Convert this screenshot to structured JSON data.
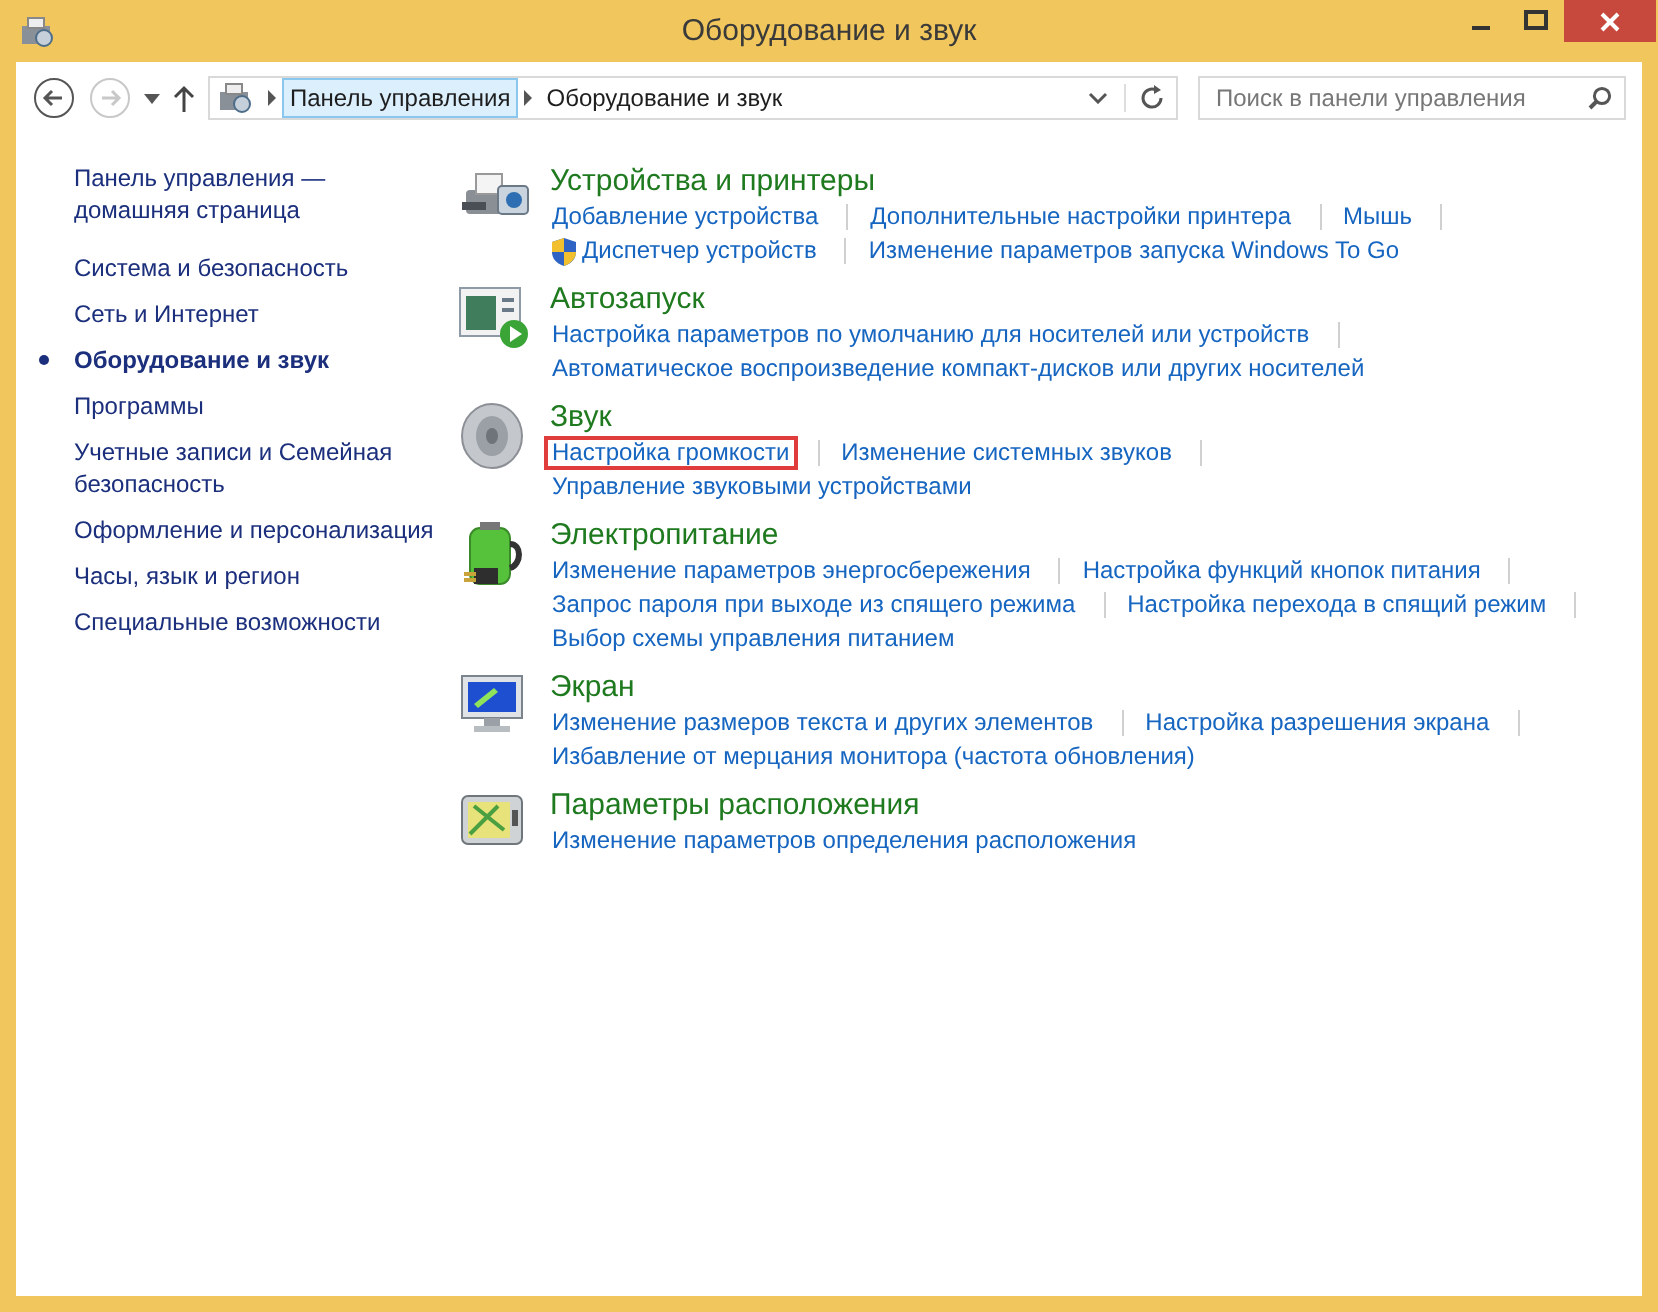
{
  "window": {
    "title": "Оборудование и звук"
  },
  "address": {
    "crumbs": [
      {
        "label": "Панель управления",
        "selected": true
      },
      {
        "label": "Оборудование и звук",
        "selected": false
      }
    ]
  },
  "search": {
    "placeholder": "Поиск в панели управления"
  },
  "sidebar": {
    "items": [
      {
        "label": "Панель управления — домашняя страница",
        "selected": false
      },
      {
        "label": "Система и безопасность",
        "selected": false
      },
      {
        "label": "Сеть и Интернет",
        "selected": false
      },
      {
        "label": "Оборудование и звук",
        "selected": true
      },
      {
        "label": "Программы",
        "selected": false
      },
      {
        "label": "Учетные записи и Семейная безопасность",
        "selected": false
      },
      {
        "label": "Оформление и персонализация",
        "selected": false
      },
      {
        "label": "Часы, язык и регион",
        "selected": false
      },
      {
        "label": "Специальные возможности",
        "selected": false
      }
    ]
  },
  "sections": [
    {
      "kind": "printer",
      "title": "Устройства и принтеры",
      "lines": [
        [
          {
            "label": "Добавление устройства"
          },
          {
            "label": "Дополнительные настройки принтера"
          },
          {
            "label": "Мышь"
          }
        ],
        [
          {
            "label": "Диспетчер устройств",
            "shield": true
          },
          {
            "label": "Изменение параметров запуска Windows To Go"
          }
        ]
      ]
    },
    {
      "kind": "autoplay",
      "title": "Автозапуск",
      "lines": [
        [
          {
            "label": "Настройка параметров по умолчанию для носителей или устройств"
          }
        ],
        [
          {
            "label": "Автоматическое воспроизведение компакт-дисков или других носителей"
          }
        ]
      ]
    },
    {
      "kind": "speaker",
      "title": "Звук",
      "lines": [
        [
          {
            "label": "Настройка громкости",
            "highlighted": true
          },
          {
            "label": "Изменение системных звуков"
          }
        ],
        [
          {
            "label": "Управление звуковыми устройствами"
          }
        ]
      ]
    },
    {
      "kind": "battery",
      "title": "Электропитание",
      "lines": [
        [
          {
            "label": "Изменение параметров энергосбережения"
          },
          {
            "label": "Настройка функций кнопок питания"
          }
        ],
        [
          {
            "label": "Запрос пароля при выходе из спящего режима"
          },
          {
            "label": "Настройка перехода в спящий режим"
          }
        ],
        [
          {
            "label": "Выбор схемы управления питанием"
          }
        ]
      ]
    },
    {
      "kind": "monitor",
      "title": "Экран",
      "lines": [
        [
          {
            "label": "Изменение размеров текста и других элементов"
          },
          {
            "label": "Настройка разрешения экрана"
          }
        ],
        [
          {
            "label": "Избавление от мерцания монитора (частота обновления)"
          }
        ]
      ]
    },
    {
      "kind": "location",
      "title": "Параметры расположения",
      "lines": [
        [
          {
            "label": "Изменение параметров определения расположения"
          }
        ]
      ]
    }
  ]
}
